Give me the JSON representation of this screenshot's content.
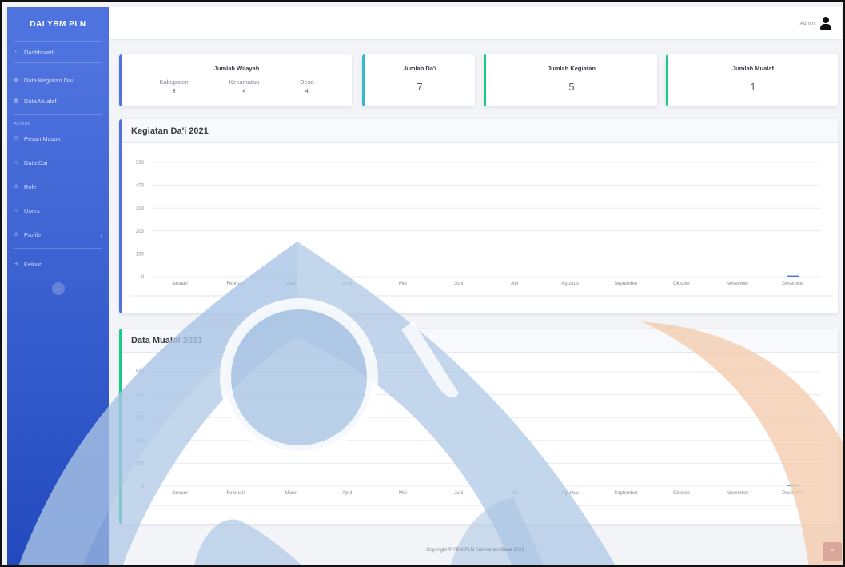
{
  "sidebar": {
    "brand": "DAI YBM PLN",
    "items": [
      {
        "label": "Dashboard",
        "icon": "dashboard-icon"
      },
      {
        "label": "Data Kegiatan Dai",
        "icon": "table-icon"
      },
      {
        "label": "Data Mualaf",
        "icon": "table-icon"
      }
    ],
    "heading": "ADMIN",
    "admin_items": [
      {
        "label": "Pesan Masuk",
        "icon": "envelope-icon"
      },
      {
        "label": "Data Dai",
        "icon": "users-icon"
      },
      {
        "label": "Role",
        "icon": "user-icon"
      },
      {
        "label": "Users",
        "icon": "users-icon"
      },
      {
        "label": "Profile",
        "icon": "user-icon"
      }
    ],
    "logout": "Keluar"
  },
  "topbar": {
    "username": "Admin"
  },
  "stats": {
    "wilayah": {
      "title": "Jumlah Wilayah",
      "cols": [
        {
          "label": "Kabupaten",
          "value": "3"
        },
        {
          "label": "Kecamatan",
          "value": "4"
        },
        {
          "label": "Desa",
          "value": "4"
        }
      ]
    },
    "dai": {
      "title": "Jumlah Da'i",
      "value": "7"
    },
    "kegiatan": {
      "title": "Jumlah Kegiatan",
      "value": "5"
    },
    "mualaf": {
      "title": "Jumlah Mualaf",
      "value": "1"
    }
  },
  "charts": {
    "kegiatan_title": "Kegiatan Da'i 2021",
    "mualaf_title": "Data Mualaf 2021"
  },
  "chart_data": [
    {
      "type": "bar",
      "title": "Kegiatan Da'i 2021",
      "categories": [
        "Januari",
        "Februari",
        "Maret",
        "April",
        "Mei",
        "Juni",
        "Juli",
        "Agustus",
        "September",
        "Oktober",
        "November",
        "Desember"
      ],
      "values": [
        0,
        0,
        0,
        0,
        0,
        0,
        0,
        0,
        0,
        0,
        0,
        5
      ],
      "yticks": [
        "0",
        "100",
        "200",
        "300",
        "400",
        "500"
      ],
      "ylim": [
        0,
        500
      ],
      "color": "#4e73df"
    },
    {
      "type": "bar",
      "title": "Data Mualaf 2021",
      "categories": [
        "Januari",
        "Februari",
        "Maret",
        "April",
        "Mei",
        "Juni",
        "Juli",
        "Agustus",
        "September",
        "Oktober",
        "November",
        "Desember"
      ],
      "values": [
        0,
        0,
        0,
        0,
        0,
        0,
        0,
        0,
        0,
        0,
        0,
        1
      ],
      "yticks": [
        "0",
        "100",
        "200",
        "300",
        "400",
        "500"
      ],
      "ylim": [
        0,
        500
      ],
      "color": "#36b9cc"
    }
  ],
  "footer": "Copyright © YBM PLN Kalimantan Barat 2021",
  "colors": {
    "primary": "#4e73df",
    "info": "#36b9cc",
    "success": "#1cc88a",
    "watermark_blue": "#a9c4e4",
    "watermark_orange": "#f3c8a8"
  }
}
